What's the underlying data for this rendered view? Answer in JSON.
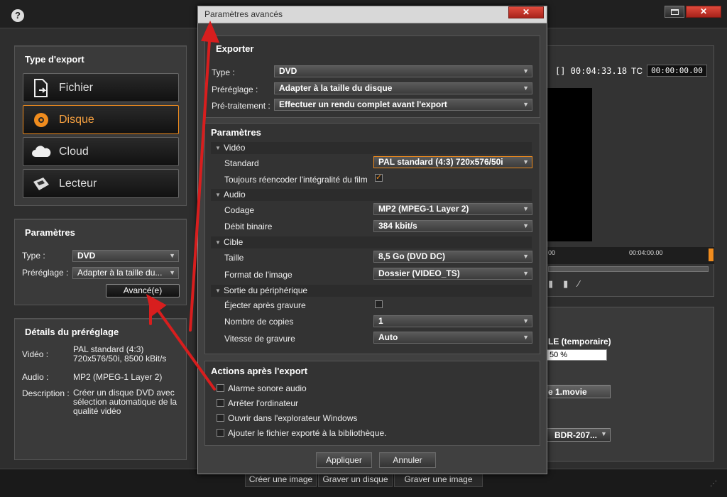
{
  "help_icon": "help-icon",
  "export_type": {
    "title": "Type d'export",
    "options": [
      {
        "label": "Fichier",
        "icon": "file-export-icon"
      },
      {
        "label": "Disque",
        "icon": "disc-icon"
      },
      {
        "label": "Cloud",
        "icon": "cloud-icon"
      },
      {
        "label": "Lecteur",
        "icon": "device-icon"
      }
    ]
  },
  "left_params": {
    "title": "Paramètres",
    "type_label": "Type :",
    "type_value": "DVD",
    "preset_label": "Préréglage :",
    "preset_value": "Adapter à la taille du...",
    "advanced_button": "Avancé(e)"
  },
  "preset_details": {
    "title": "Détails du préréglage",
    "video_label": "Vidéo :",
    "video_value": "PAL standard (4:3) 720x576/50i, 8500 kBit/s",
    "audio_label": "Audio :",
    "audio_value": "MP2 (MPEG-1 Layer 2)",
    "desc_label": "Description :",
    "desc_value": "Créer un disque DVD avec sélection automatique de la qualité vidéo"
  },
  "timeline": {
    "duration": "[] 00:04:33.18",
    "tc_label": "TC",
    "tc_value": "00:00:00.00",
    "ruler_left": "00",
    "ruler_mark": "00:04:00.00"
  },
  "right_panel": {
    "temp_text": "LE (temporaire)",
    "progress_text": "50 %",
    "movie_text": "e 1.movie",
    "drive_text": "BDR-207..."
  },
  "bottom_bar": {
    "create_image": "Créer une image",
    "burn_disc": "Graver un disque",
    "burn_image": "Graver une image"
  },
  "dialog": {
    "title": "Paramètres avancés",
    "export_section": "Exporter",
    "type_label": "Type :",
    "type_value": "DVD",
    "preset_label": "Préréglage :",
    "preset_value": "Adapter à la taille du disque",
    "pretreat_label": "Pré-traitement :",
    "pretreat_value": "Effectuer un rendu complet avant l'export",
    "params_section": "Paramètres",
    "video_group": "Vidéo",
    "standard_label": "Standard",
    "standard_value": "PAL standard (4:3) 720x576/50i",
    "reencode_label": "Toujours réencoder l'intégralité du film",
    "audio_group": "Audio",
    "codec_label": "Codage",
    "codec_value": "MP2 (MPEG-1 Layer 2)",
    "bitrate_label": "Débit binaire",
    "bitrate_value": "384 kbit/s",
    "target_group": "Cible",
    "size_label": "Taille",
    "size_value": "8,5 Go (DVD DC)",
    "format_label": "Format de l'image",
    "format_value": "Dossier (VIDEO_TS)",
    "device_group": "Sortie du périphérique",
    "eject_label": "Éjecter après gravure",
    "copies_label": "Nombre de copies",
    "copies_value": "1",
    "speed_label": "Vitesse de gravure",
    "speed_value": "Auto",
    "actions_section": "Actions après l'export",
    "action_1": "Alarme sonore audio",
    "action_2": "Arrêter l'ordinateur",
    "action_3": "Ouvrir dans l'explorateur Windows",
    "action_4": "Ajouter le fichier exporté à la bibliothèque.",
    "apply_button": "Appliquer",
    "cancel_button": "Annuler"
  },
  "colors": {
    "accent": "#f08c1e",
    "close_red": "#c8322a",
    "arrow_red": "#d81e1e"
  }
}
